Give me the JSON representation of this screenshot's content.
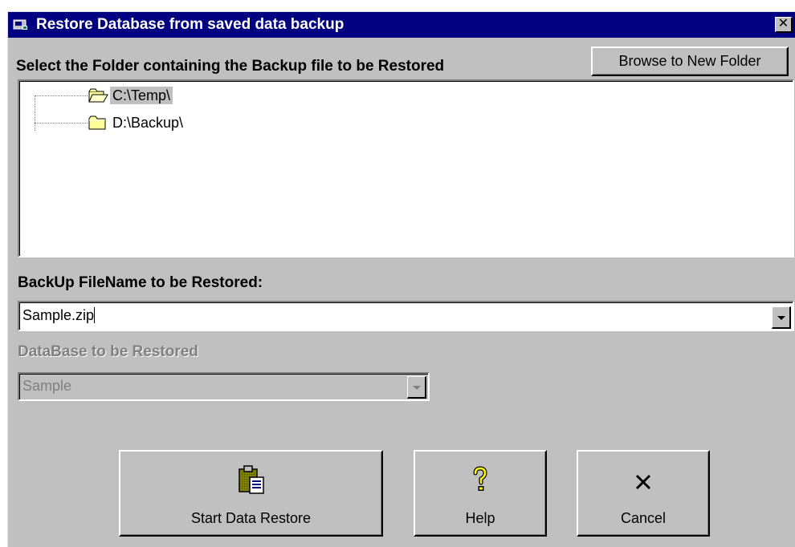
{
  "window": {
    "title": "Restore Database from saved data backup",
    "close_glyph": "✕",
    "colors": {
      "titlebar": "#000080",
      "face": "#c0c0c0"
    }
  },
  "folder_section": {
    "label": "Select the Folder containing the Backup file to be Restored",
    "browse_label": "Browse to New Folder",
    "folders": [
      {
        "label": "C:\\Temp\\",
        "selected": true,
        "icon": "open-folder-icon"
      },
      {
        "label": "D:\\Backup\\",
        "selected": false,
        "icon": "folder-icon"
      }
    ]
  },
  "backup_file": {
    "label": "BackUp FileName to be Restored:",
    "value": "Sample.zip"
  },
  "database": {
    "label": "DataBase to be Restored",
    "value": "Sample",
    "enabled": false
  },
  "actions": {
    "start_label": "Start Data Restore",
    "help_label": "Help",
    "cancel_label": "Cancel",
    "icons": [
      "clipboard-icon",
      "help-icon",
      "close-icon"
    ]
  }
}
